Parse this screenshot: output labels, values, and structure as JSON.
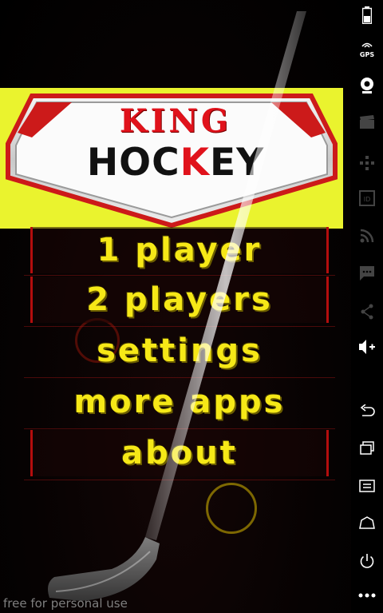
{
  "logo": {
    "top_word": "KING",
    "bottom_word_start": "HOC",
    "bottom_word_accent": "K",
    "bottom_word_end": "EY"
  },
  "menu": {
    "items": [
      {
        "label": "1 player"
      },
      {
        "label": "2 players"
      },
      {
        "label": "settings"
      },
      {
        "label": "more apps"
      },
      {
        "label": "about"
      }
    ]
  },
  "watermark": "free for personal use",
  "system_bar": {
    "gps_label": "GPS",
    "icons": [
      "battery-icon",
      "gps-icon",
      "webcam-icon",
      "clapperboard-icon",
      "dpad-icon",
      "id-icon",
      "rss-icon",
      "chat-icon",
      "share-icon",
      "volume-up-icon",
      "back-icon",
      "recent-apps-icon",
      "menu-icon",
      "home-icon",
      "power-icon",
      "more-icon"
    ]
  },
  "colors": {
    "banner": "#eaf32e",
    "logo_red": "#e0121b",
    "menu_text": "#f6e817",
    "menu_border": "#b40d0d",
    "background": "#000000"
  }
}
